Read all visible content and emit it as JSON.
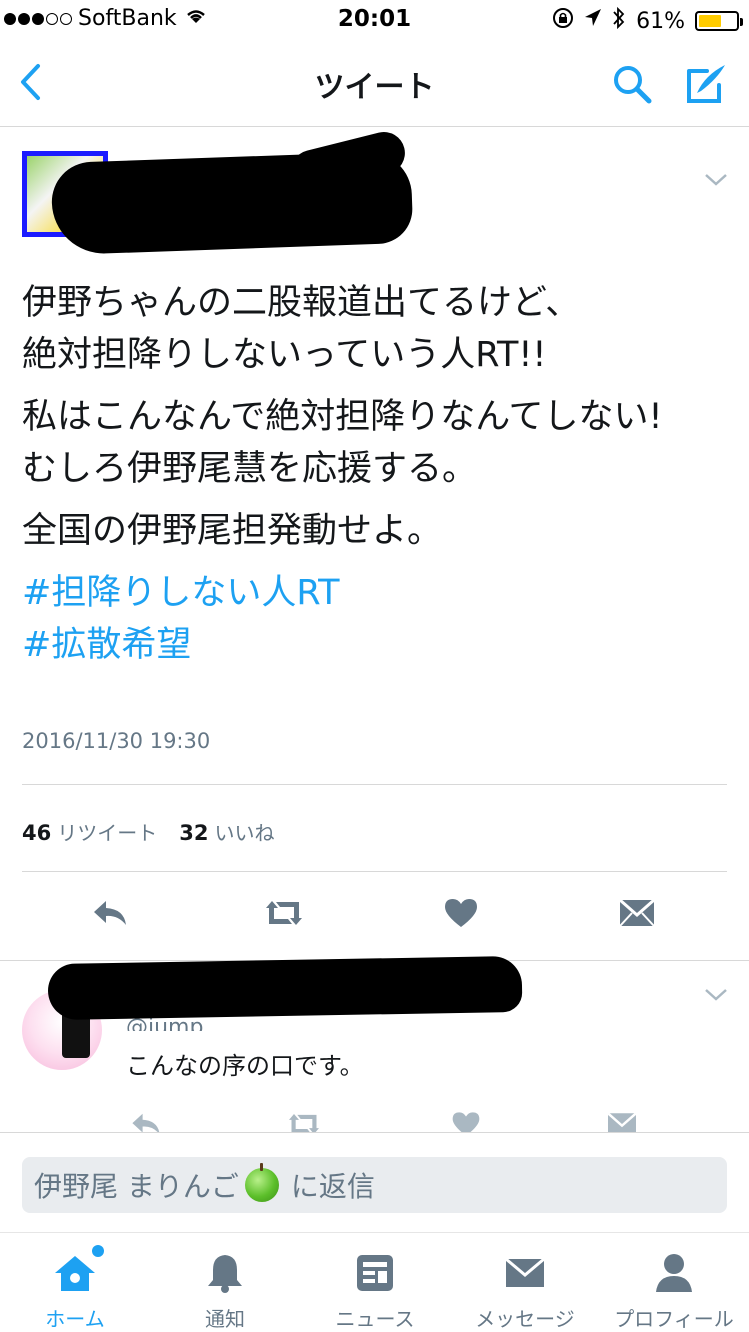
{
  "status_bar": {
    "carrier": "SoftBank",
    "time": "20:01",
    "battery_percent": "61%",
    "battery_level": 0.61,
    "battery_color": "#ffcc00",
    "signal_bars": 3,
    "signal_total": 5
  },
  "nav": {
    "title": "ツイート",
    "back_icon": "chevron-left-icon",
    "search_icon": "search-icon",
    "compose_icon": "compose-icon"
  },
  "tweet": {
    "text": {
      "line1": "伊野ちゃんの二股報道出てるけど、",
      "line2": "絶対担降りしないっていう人RT!!",
      "line3": "私はこんなんで絶対担降りなんてしない!",
      "line4": "むしろ伊野尾慧を応援する。",
      "line5": "全国の伊野尾担発動せよ。"
    },
    "hashtags": [
      "#担降りしない人RT",
      "#拡散希望"
    ],
    "date": "2016/11/30 19:30",
    "retweets": "46",
    "retweets_label": "リツイート",
    "likes": "32",
    "likes_label": "いいね"
  },
  "reply": {
    "handle_partial": "@jump_...",
    "text": "こんなの序の口です。"
  },
  "reply_bar": {
    "prefix": "伊野尾 まりんご",
    "suffix": "に返信"
  },
  "tabs": [
    {
      "label": "ホーム",
      "icon": "home-icon",
      "active": true
    },
    {
      "label": "通知",
      "icon": "bell-icon",
      "active": false
    },
    {
      "label": "ニュース",
      "icon": "news-icon",
      "active": false
    },
    {
      "label": "メッセージ",
      "icon": "envelope-icon",
      "active": false
    },
    {
      "label": "プロフィール",
      "icon": "person-icon",
      "active": false
    }
  ],
  "colors": {
    "accent": "#1da1f2",
    "text": "#14171a",
    "muted": "#657786",
    "icon_gray": "#657786"
  }
}
